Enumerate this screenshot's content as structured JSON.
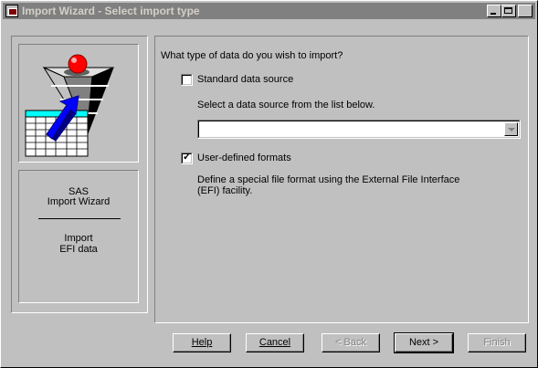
{
  "window": {
    "title": "Import Wizard - Select import type"
  },
  "left_panel": {
    "product": "SAS",
    "wizard": "Import Wizard",
    "step_line1": "Import",
    "step_line2": "EFI data"
  },
  "main": {
    "question": "What type of data do you wish to import?",
    "option_standard": {
      "label": "Standard data source",
      "checked": false
    },
    "source_hint": "Select a data source from the list below.",
    "source_select_value": "",
    "option_user_defined": {
      "label": "User-defined formats",
      "checked": true
    },
    "user_defined_desc": "Define a special file format using the External File Interface (EFI) facility."
  },
  "buttons": {
    "help": "Help",
    "cancel": "Cancel",
    "back": "< Back",
    "next": "Next >",
    "finish": "Finish"
  },
  "colors": {
    "face": "#c0c0c0",
    "title_inactive": "#808080",
    "pyramid_red": "#ff0000",
    "arrow_blue": "#0000ff",
    "grid_cyan": "#00ffff"
  },
  "icons": {
    "title": "app-window-icon",
    "illustration": "import-pyramid-illustration"
  }
}
